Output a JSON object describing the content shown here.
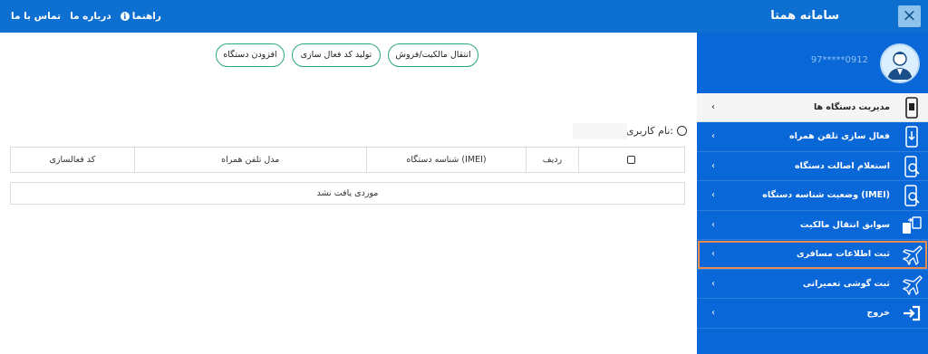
{
  "topbar": {
    "title": "سامانه همتا",
    "close_icon": "×",
    "links": [
      "تماس با ما",
      "درباره ما",
      "راهنما"
    ],
    "help_icon": "i"
  },
  "sidebar": {
    "phone": "97*****0912",
    "items": [
      {
        "label": "مدیریت دستگاه ها",
        "icon": "device-management-icon"
      },
      {
        "label": "فعال سازی تلفن همراه",
        "icon": "phone-activation-icon"
      },
      {
        "label": "استعلام اصالت دستگاه",
        "icon": "phone-search-icon"
      },
      {
        "label": "وضعیت شناسه دستگاه (IMEI)",
        "icon": "phone-search-icon"
      },
      {
        "label": "سوابق انتقال مالکیت",
        "icon": "transfer-history-icon"
      },
      {
        "label": "ثبت اطلاعات مسافری",
        "icon": "airplane-icon"
      },
      {
        "label": "ثبت گوشی تعمیراتی",
        "icon": "airplane-icon"
      },
      {
        "label": "خروج",
        "icon": "logout-icon"
      }
    ]
  },
  "main": {
    "buttons": {
      "transfer": "انتقال مالکیت/فروش",
      "generate_code": "تولید کد فعال سازی",
      "add_device": "افزودن دستگاه"
    },
    "username_label": "نام کاربری:",
    "table": {
      "headers": [
        "ردیف",
        "شناسه دستگاه (IMEI)",
        "مدل تلفن همراه",
        "کد فعالسازی"
      ],
      "empty_text": "موردی یافت نشد"
    }
  },
  "colors": {
    "primary": "#0d6fd0",
    "sidebar": "#0a67d8",
    "pill_border": "#2aa77a",
    "highlight": "#e98d4f"
  }
}
